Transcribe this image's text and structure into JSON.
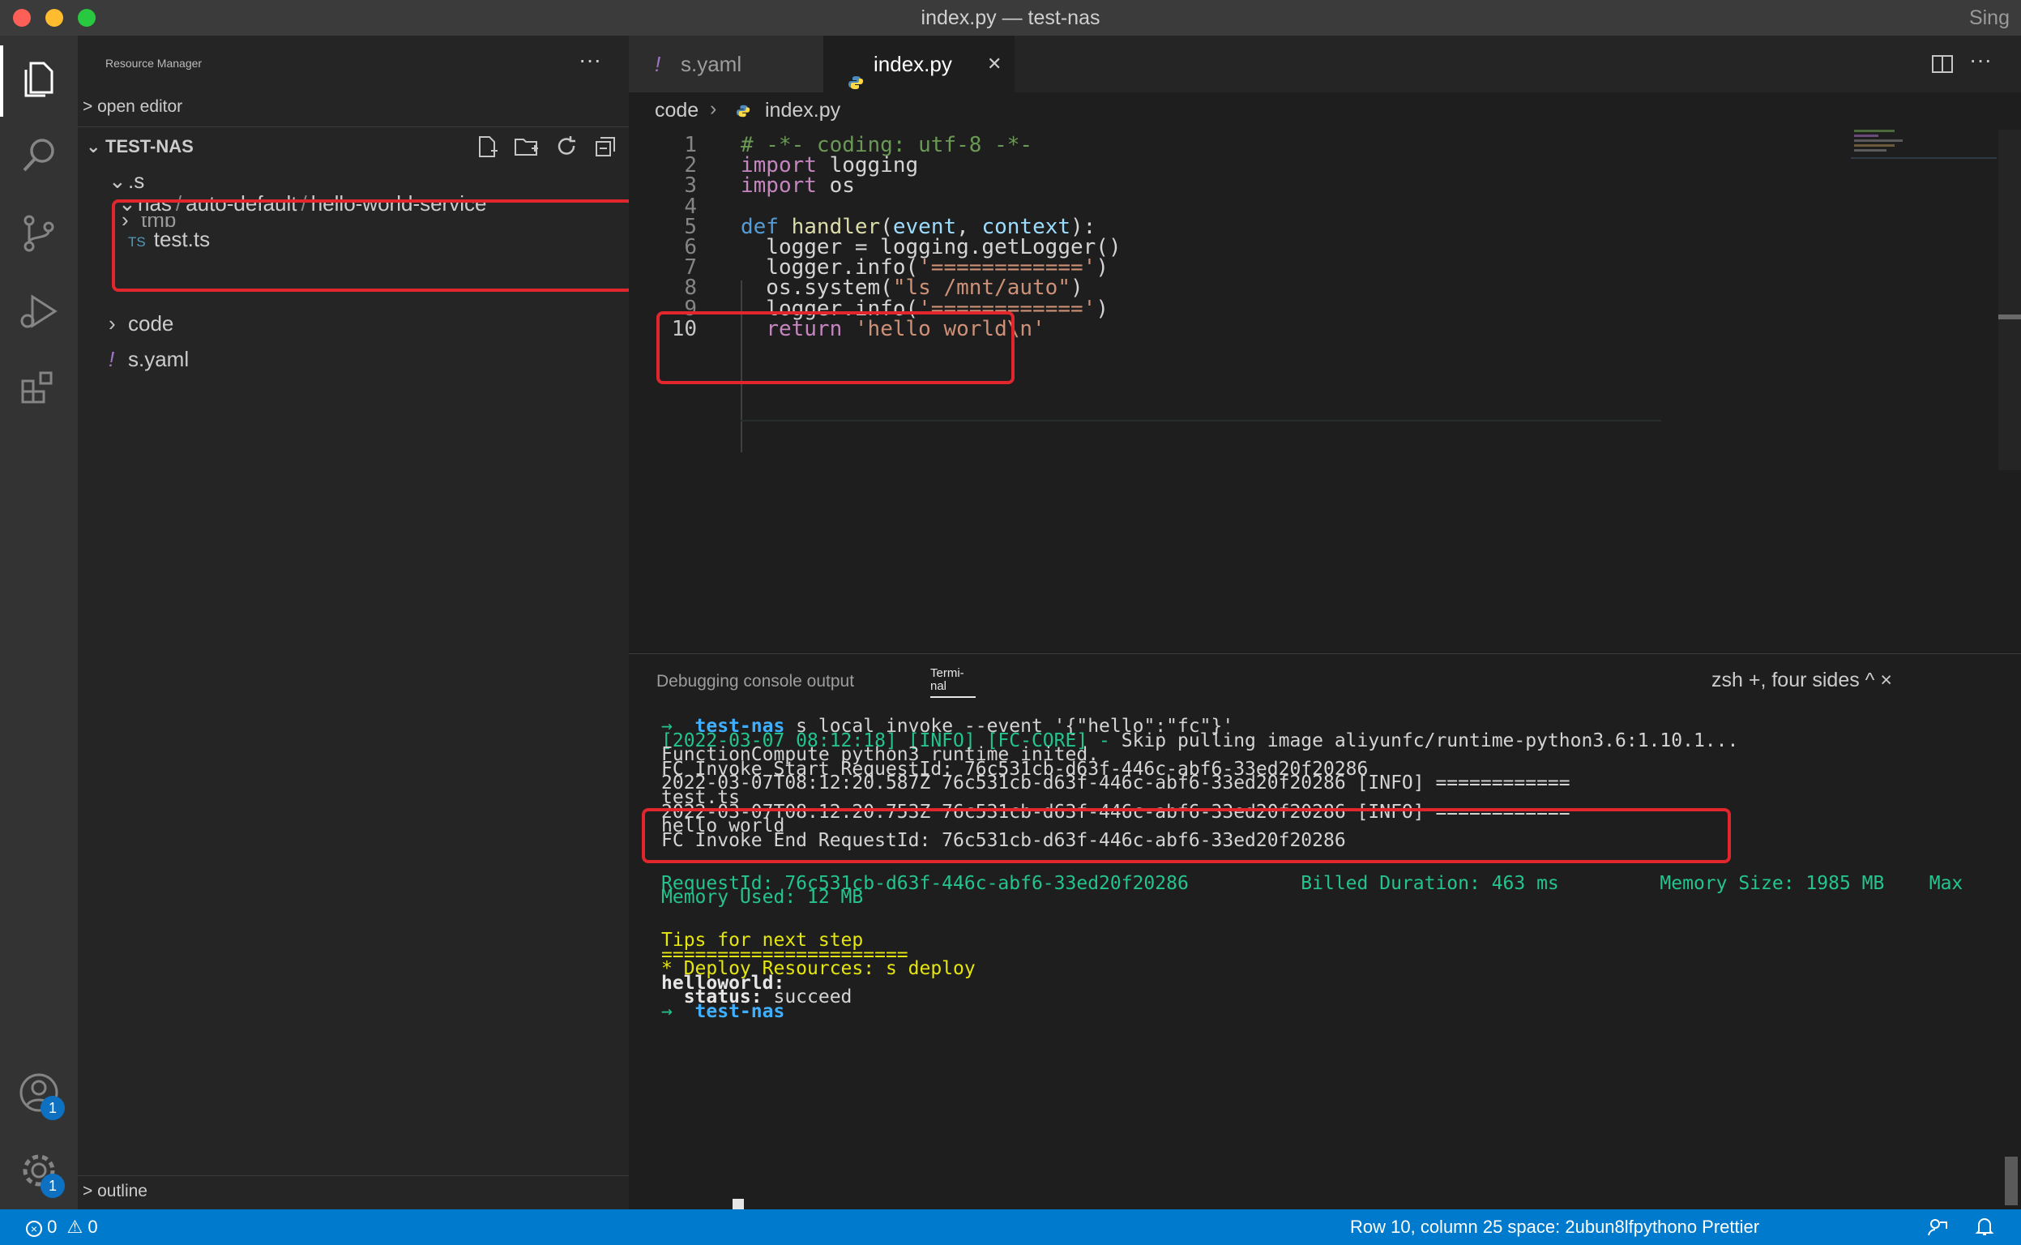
{
  "window": {
    "title": "index.py — test-nas",
    "title_right": "Sing"
  },
  "colors": {
    "accent": "#007acc",
    "highlight_box": "#e1262d",
    "activity_bg": "#333333",
    "sidebar_bg": "#252526",
    "editor_bg": "#1e1e1e"
  },
  "activity_bar": {
    "icons": [
      "explorer-icon",
      "search-icon",
      "source-control-icon",
      "run-debug-icon",
      "extensions-icon"
    ],
    "bottom_icons": [
      "accounts-icon",
      "settings-gear-icon"
    ],
    "accounts_badge": "1",
    "settings_badge": "1"
  },
  "sidebar": {
    "header": "Resource Manager",
    "more": "···",
    "open_editors": "> open editor",
    "project": "TEST-NAS",
    "tree": {
      "s_folder": ".s",
      "nas_path": [
        "nas",
        "/",
        "auto-default",
        "/",
        "hello-world-service"
      ],
      "test_ts_badge": "TS",
      "test_ts": "test.ts",
      "tmp": "tmp",
      "code": "code",
      "syaml_icon": "!",
      "syaml": "s.yaml"
    },
    "outline": "> outline"
  },
  "tabs": [
    {
      "icon": "!",
      "label": "s.yaml",
      "active": false
    },
    {
      "icon": "python-icon",
      "label": "index.py",
      "active": true,
      "close": "✕"
    }
  ],
  "breadcrumb": {
    "folder": "code",
    "sep": "›",
    "file": "index.py"
  },
  "editor": {
    "line_numbers": [
      "1",
      "2",
      "3",
      "4",
      "5",
      "6",
      "7",
      "8",
      "9",
      "10"
    ],
    "lines": [
      [
        [
          "cm",
          "# -*- coding: utf-8 -*-"
        ]
      ],
      [
        [
          "kw2",
          "import"
        ],
        [
          "plain",
          " logging"
        ]
      ],
      [
        [
          "kw2",
          "import"
        ],
        [
          "plain",
          " os"
        ]
      ],
      [],
      [
        [
          "kw",
          "def"
        ],
        [
          "plain",
          " "
        ],
        [
          "fn",
          "handler"
        ],
        [
          "plain",
          "("
        ],
        [
          "pm",
          "event"
        ],
        [
          "plain",
          ", "
        ],
        [
          "pm",
          "context"
        ],
        [
          "plain",
          "):"
        ]
      ],
      [
        [
          "plain",
          "  logger = logging.getLogger()"
        ]
      ],
      [
        [
          "plain",
          "  logger.info("
        ],
        [
          "str",
          "'============'"
        ],
        [
          "plain",
          ")"
        ]
      ],
      [
        [
          "plain",
          "  os.system("
        ],
        [
          "str",
          "\"ls /mnt/auto\""
        ],
        [
          "plain",
          ")"
        ]
      ],
      [
        [
          "plain",
          "  logger.info("
        ],
        [
          "str",
          "'============'"
        ],
        [
          "plain",
          ")"
        ]
      ],
      [
        [
          "plain",
          "  "
        ],
        [
          "kw2",
          "return"
        ],
        [
          "plain",
          " "
        ],
        [
          "str",
          "'hello world\\n'"
        ]
      ]
    ]
  },
  "panel": {
    "tab_debug": "Debugging console output",
    "tab_terminal_1": "Termi-",
    "tab_terminal_2": "nal",
    "terminal_controls": "zsh +, four sides ^ ×",
    "lines": [
      [
        [
          "t-green",
          "→  "
        ],
        [
          "t-cyan t-bold",
          "test-nas"
        ],
        [
          "plain",
          " s local invoke --event '{\"hello\":\"fc\"}'"
        ]
      ],
      [
        [
          "t-green",
          "[2022-03-07 08:12:18] [INFO] [FC-CORE] - "
        ],
        [
          "plain",
          "Skip pulling image aliyunfc/runtime-python3.6:1.10.1..."
        ]
      ],
      [
        [
          "plain",
          "FunctionCompute python3 runtime inited."
        ]
      ],
      [
        [
          "plain",
          "FC Invoke Start RequestId: 76c531cb-d63f-446c-abf6-33ed20f20286"
        ]
      ],
      [
        [
          "plain",
          "2022-03-07T08:12:20.587Z 76c531cb-d63f-446c-abf6-33ed20f20286 [INFO] ============"
        ]
      ],
      [
        [
          "plain",
          "test.ts"
        ]
      ],
      [
        [
          "plain",
          "2022-03-07T08:12:20.753Z 76c531cb-d63f-446c-abf6-33ed20f20286 [INFO] ============"
        ]
      ],
      [
        [
          "plain",
          "hello world"
        ]
      ],
      [
        [
          "plain",
          "FC Invoke End RequestId: 76c531cb-d63f-446c-abf6-33ed20f20286"
        ]
      ],
      [],
      [],
      [
        [
          "t-green",
          "RequestId: 76c531cb-d63f-446c-abf6-33ed20f20286          Billed Duration: 463 ms         Memory Size: 1985 MB    Max"
        ]
      ],
      [
        [
          "t-green",
          "Memory Used: 12 MB"
        ]
      ],
      [],
      [],
      [
        [
          "t-yellow",
          "Tips for next step"
        ]
      ],
      [
        [
          "t-yellow",
          "======================"
        ]
      ],
      [
        [
          "t-yellow",
          "* Deploy Resources: s deploy"
        ]
      ],
      [
        [
          "t-bold",
          "helloworld:"
        ]
      ],
      [
        [
          "t-bold",
          "  status:"
        ],
        [
          "plain",
          " succeed"
        ]
      ],
      [
        [
          "t-green",
          "→  "
        ],
        [
          "t-cyan t-bold",
          "test-nas"
        ],
        [
          "plain",
          " "
        ]
      ]
    ]
  },
  "statusbar": {
    "errors": "0",
    "warnings": "0",
    "position": "Row 10, column 25 space: 2ubun8lfpythono Prettier"
  }
}
